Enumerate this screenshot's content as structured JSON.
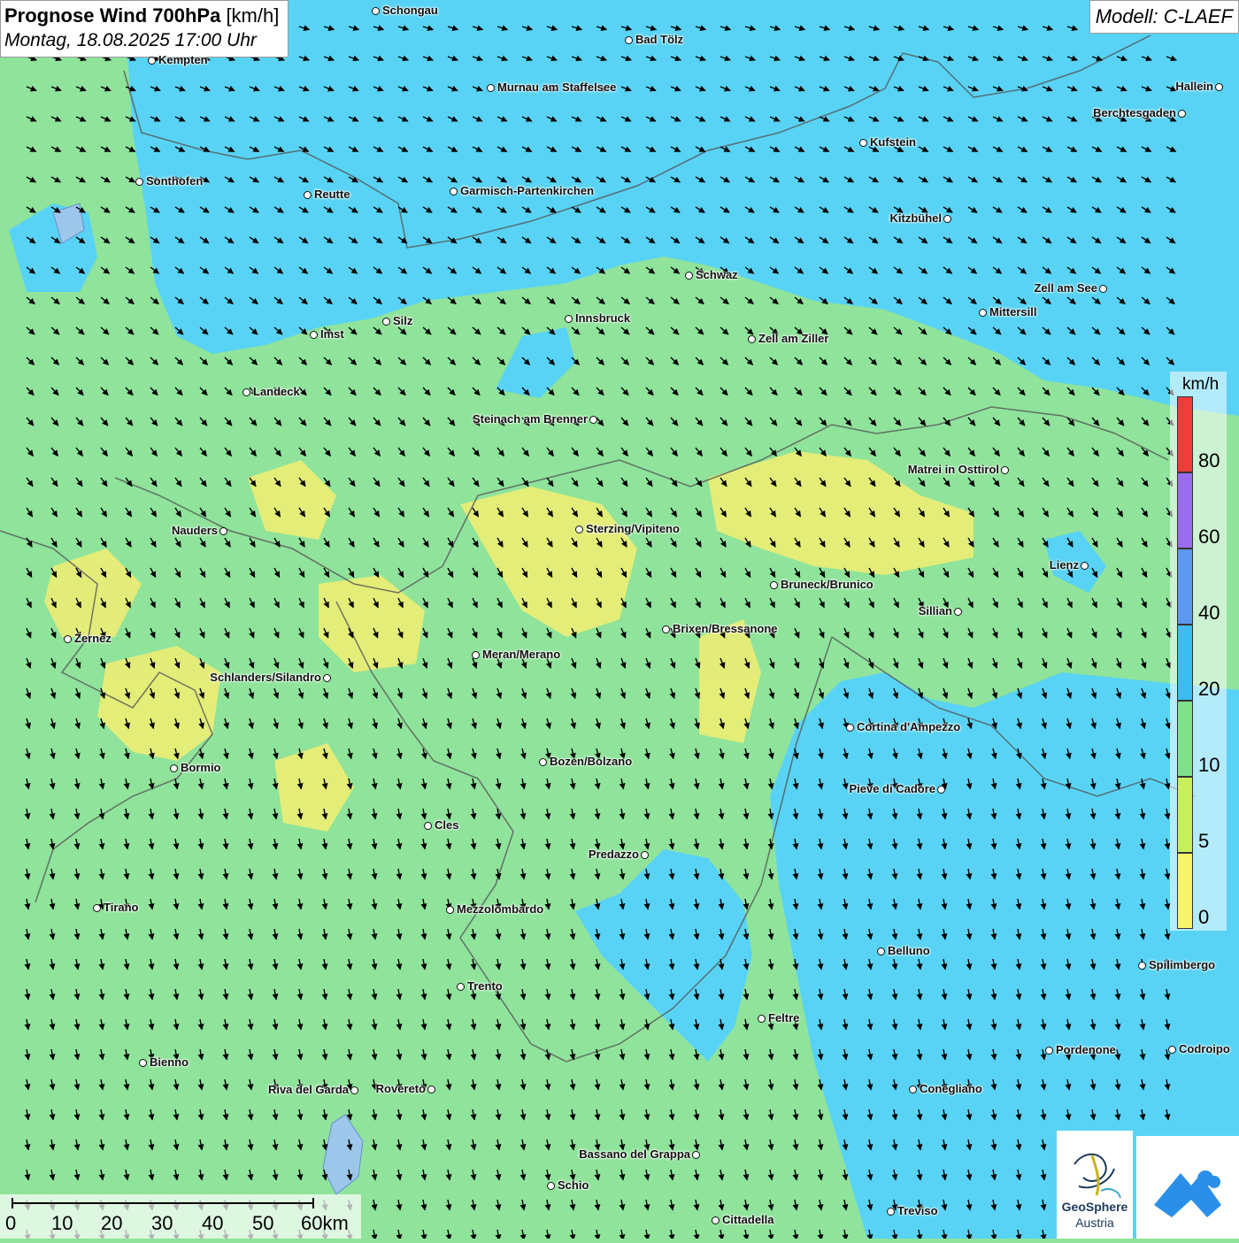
{
  "title": {
    "main_bold": "Prognose Wind 700hPa",
    "unit": "[km/h]",
    "datetime": "Montag, 18.08.2025 17:00 Uhr"
  },
  "model_label": "Modell: C-LAEF",
  "legend": {
    "unit": "km/h",
    "ticks": [
      "80",
      "60",
      "40",
      "20",
      "10",
      "5",
      "0"
    ],
    "colors": [
      "#f23b3b",
      "#9a6cf0",
      "#5d98f0",
      "#3bbdf0",
      "#7fe08a",
      "#c8ef5a",
      "#f7f36a"
    ]
  },
  "scalebar": {
    "labels": [
      "0",
      "10",
      "20",
      "30",
      "40",
      "50",
      "60km"
    ]
  },
  "logos": {
    "geosphere_line1": "GeoSphere",
    "geosphere_line2": "Austria"
  },
  "colors": {
    "fast_wind": "#58d3f5",
    "moderate_wind": "#8fe39b",
    "calm_wind": "#f2ee72",
    "border_line": "#555555"
  },
  "cities": [
    {
      "name": "Schongau"
    },
    {
      "name": "Bad Tölz"
    },
    {
      "name": "Kempten"
    },
    {
      "name": "Murnau am Staffelsee"
    },
    {
      "name": "Hallein"
    },
    {
      "name": "Berchtesgaden"
    },
    {
      "name": "Kufstein"
    },
    {
      "name": "Sonthofen"
    },
    {
      "name": "Reutte"
    },
    {
      "name": "Garmisch-Partenkirchen"
    },
    {
      "name": "Kitzbühel"
    },
    {
      "name": "Schwaz"
    },
    {
      "name": "Zell am See"
    },
    {
      "name": "Mittersill"
    },
    {
      "name": "Innsbruck"
    },
    {
      "name": "Silz"
    },
    {
      "name": "Imst"
    },
    {
      "name": "Zell am Ziller"
    },
    {
      "name": "Landeck"
    },
    {
      "name": "Steinach am Brenner"
    },
    {
      "name": "Matrei in Osttirol"
    },
    {
      "name": "Nauders"
    },
    {
      "name": "Sterzing/Vipiteno"
    },
    {
      "name": "Lienz"
    },
    {
      "name": "Bruneck/Brunico"
    },
    {
      "name": "Sillian"
    },
    {
      "name": "Brixen/Bressanone"
    },
    {
      "name": "Zernez"
    },
    {
      "name": "Meran/Merano"
    },
    {
      "name": "Schlanders/Silandro"
    },
    {
      "name": "Cortina d'Ampezzo"
    },
    {
      "name": "Bozen/Bolzano"
    },
    {
      "name": "Bormio"
    },
    {
      "name": "Pieve di Cadore"
    },
    {
      "name": "Cles"
    },
    {
      "name": "Predazzo"
    },
    {
      "name": "Tirano"
    },
    {
      "name": "Mezzolombardo"
    },
    {
      "name": "Belluno"
    },
    {
      "name": "Spilimbergo"
    },
    {
      "name": "Trento"
    },
    {
      "name": "Feltre"
    },
    {
      "name": "Bienno"
    },
    {
      "name": "Pordenone"
    },
    {
      "name": "Codroipo"
    },
    {
      "name": "Riva del Garda"
    },
    {
      "name": "Rovereto"
    },
    {
      "name": "Conegliano"
    },
    {
      "name": "Bassano del Grappa"
    },
    {
      "name": "Schio"
    },
    {
      "name": "Treviso"
    },
    {
      "name": "Cittadella"
    }
  ]
}
